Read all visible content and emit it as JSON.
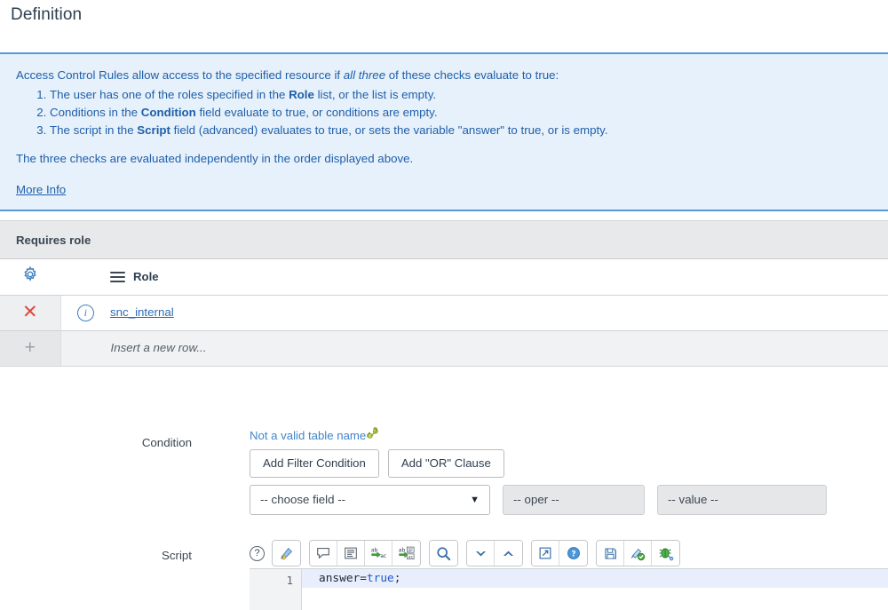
{
  "section": {
    "title": "Definition"
  },
  "info_banner": {
    "intro_before": "Access Control Rules allow access to the specified resource if ",
    "intro_emphasis": "all three",
    "intro_after": " of these checks evaluate to true:",
    "rules": [
      {
        "before": "The user has one of the roles specified in the ",
        "bold": "Role",
        "after": " list, or the list is empty."
      },
      {
        "before": "Conditions in the ",
        "bold": "Condition",
        "after": " field evaluate to true, or conditions are empty."
      },
      {
        "before": "The script in the ",
        "bold": "Script",
        "after": " field (advanced) evaluates to true, or sets the variable \"answer\" to true, or is empty."
      }
    ],
    "closing": "The three checks are evaluated independently in the order displayed above.",
    "more_info_label": "More Info",
    "background_color": "#e7f1fb",
    "border_color": "#5a9ad4",
    "text_color": "#1f5fa9"
  },
  "related_list": {
    "caption": "Requires role",
    "column_header": "Role",
    "gear_icon": "gear-icon",
    "menu_icon": "hamburger-icon",
    "rows": [
      {
        "delete_icon": "x-delete-icon",
        "info_icon": "info-circle-icon",
        "role": "snc_internal"
      }
    ],
    "insert_row": {
      "plus_icon": "plus-icon",
      "label": "Insert a new row..."
    }
  },
  "condition": {
    "label": "Condition",
    "invalid_table_text": "Not a valid table name",
    "chain_icon": "chain-link-icon",
    "add_filter_label": "Add Filter Condition",
    "add_or_label": "Add \"OR\" Clause",
    "field_select_value": "-- choose field --",
    "caret_icon": "chevron-down-icon",
    "oper_value": "-- oper --",
    "value_value": "-- value --"
  },
  "script": {
    "label": "Script",
    "help_icon": "question-mark-icon",
    "toolbar_groups": [
      {
        "buttons": [
          {
            "icon": "syntax-color-icon",
            "name": "syntax-editor-button"
          }
        ]
      },
      {
        "buttons": [
          {
            "icon": "comment-bubble-icon",
            "name": "toggle-comment-button"
          },
          {
            "icon": "format-lines-icon",
            "name": "format-code-button"
          },
          {
            "icon": "replace-text-icon",
            "name": "replace-button"
          },
          {
            "icon": "replace-all-icon",
            "name": "replace-all-button"
          }
        ]
      },
      {
        "buttons": [
          {
            "icon": "magnifier-icon",
            "name": "search-button"
          }
        ]
      },
      {
        "buttons": [
          {
            "icon": "chevron-down-thick-icon",
            "name": "find-next-button"
          },
          {
            "icon": "chevron-up-thick-icon",
            "name": "find-previous-button"
          }
        ]
      },
      {
        "buttons": [
          {
            "icon": "external-link-icon",
            "name": "open-fullscreen-button"
          },
          {
            "icon": "help-circle-icon",
            "name": "script-help-button"
          }
        ]
      },
      {
        "buttons": [
          {
            "icon": "floppy-save-icon",
            "name": "save-script-button"
          },
          {
            "icon": "syntax-check-icon",
            "name": "syntax-check-button"
          },
          {
            "icon": "bug-debug-icon",
            "name": "debug-script-button"
          }
        ]
      }
    ],
    "editor": {
      "line_number": "1",
      "code_prefix": "answer=",
      "code_keyword": "true",
      "code_suffix": ";",
      "highlight_color": "#e8eefb",
      "keyword_color": "#2159c9"
    }
  }
}
